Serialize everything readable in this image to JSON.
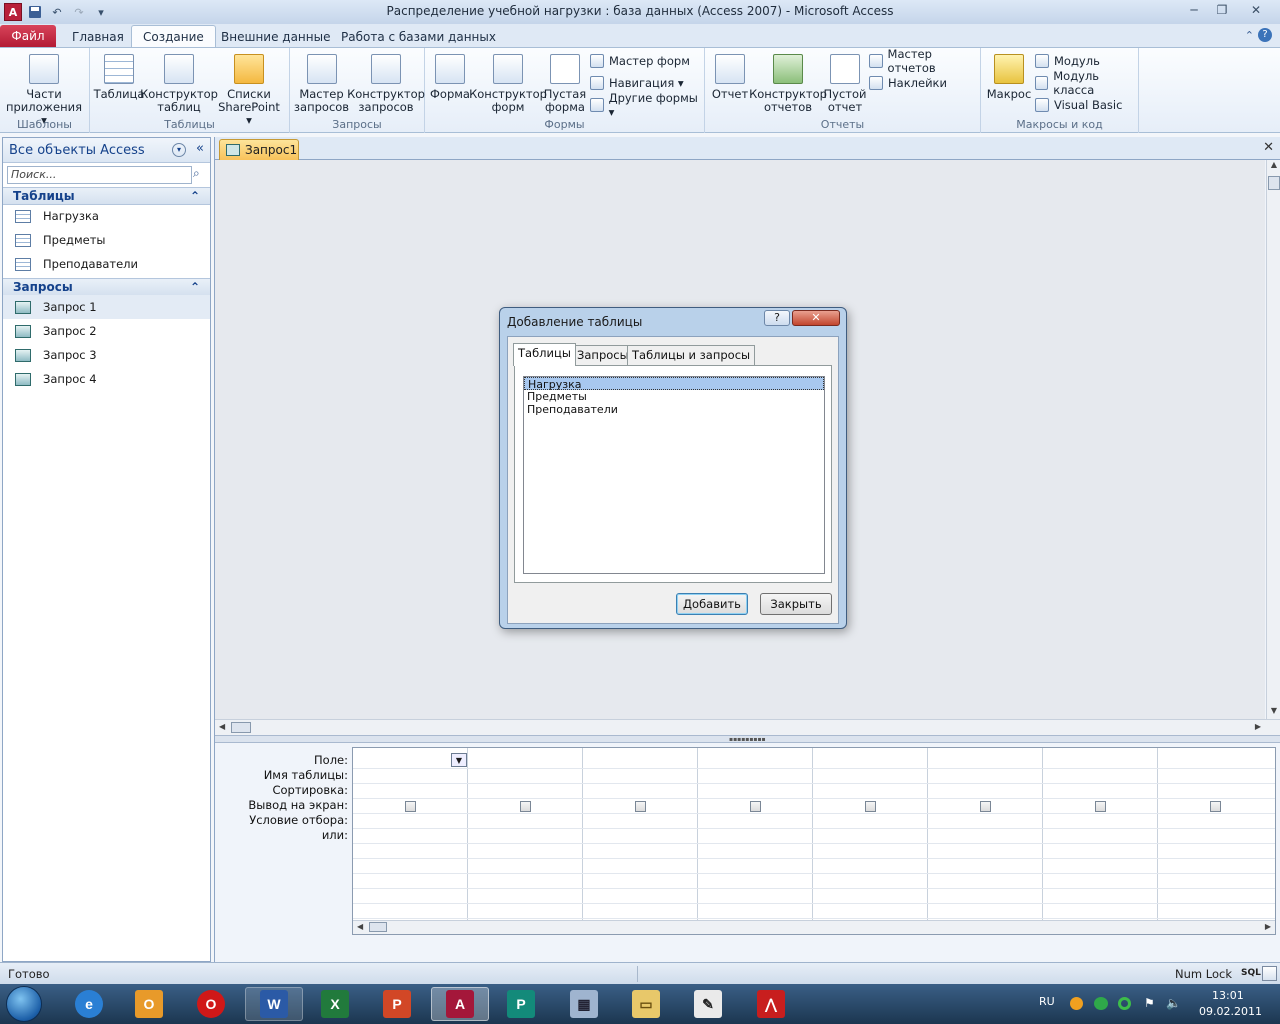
{
  "window": {
    "title": "Распределение учебной нагрузки : база данных (Access 2007)  -  Microsoft Access"
  },
  "ribbon": {
    "tabs": [
      "Файл",
      "Главная",
      "Создание",
      "Внешние данные",
      "Работа с базами данных"
    ],
    "active_tab": "Создание",
    "groups": {
      "templates": {
        "name": "Шаблоны",
        "app_parts": "Части приложения ▾"
      },
      "tables": {
        "name": "Таблицы",
        "table": "Таблица",
        "table_designer": "Конструктор таблиц",
        "sharepoint": "Списки SharePoint ▾"
      },
      "queries": {
        "name": "Запросы",
        "wizard": "Мастер запросов",
        "designer": "Конструктор запросов"
      },
      "forms": {
        "name": "Формы",
        "form": "Форма",
        "designer": "Конструктор форм",
        "blank": "Пустая форма",
        "wizard": "Мастер форм",
        "navigation": "Навигация ▾",
        "other": "Другие формы ▾"
      },
      "reports": {
        "name": "Отчеты",
        "report": "Отчет",
        "designer": "Конструктор отчетов",
        "blank": "Пустой отчет",
        "wizard": "Мастер отчетов",
        "labels": "Наклейки"
      },
      "macros": {
        "name": "Макросы и код",
        "macro": "Макрос",
        "module": "Модуль",
        "class_module": "Модуль класса",
        "vb": "Visual Basic"
      }
    }
  },
  "nav": {
    "header": "Все объекты Access",
    "search_placeholder": "Поиск...",
    "tables_header": "Таблицы",
    "tables": [
      "Нагрузка",
      "Предметы",
      "Преподаватели"
    ],
    "queries_header": "Запросы",
    "queries": [
      "Запрос 1",
      "Запрос 2",
      "Запрос 3",
      "Запрос 4"
    ]
  },
  "document": {
    "tab": "Запрос1"
  },
  "grid": {
    "row_labels": [
      "Поле:",
      "Имя таблицы:",
      "Сортировка:",
      "Вывод на экран:",
      "Условие отбора:",
      "или:"
    ]
  },
  "dialog": {
    "title": "Добавление таблицы",
    "tabs": [
      "Таблицы",
      "Запросы",
      "Таблицы и запросы"
    ],
    "items": [
      "Нагрузка",
      "Предметы",
      "Преподаватели"
    ],
    "selected": "Нагрузка",
    "add_label": "Добавить",
    "close_label": "Закрыть"
  },
  "status": {
    "left": "Готово",
    "numlock": "Num Lock",
    "sql": "SQL"
  },
  "taskbar": {
    "lang": "RU",
    "time": "13:01",
    "date": "09.02.2011"
  },
  "colors": {
    "file_tab": "#c42a42",
    "accent": "#15428b",
    "taskbar": "#2a4a6e"
  }
}
